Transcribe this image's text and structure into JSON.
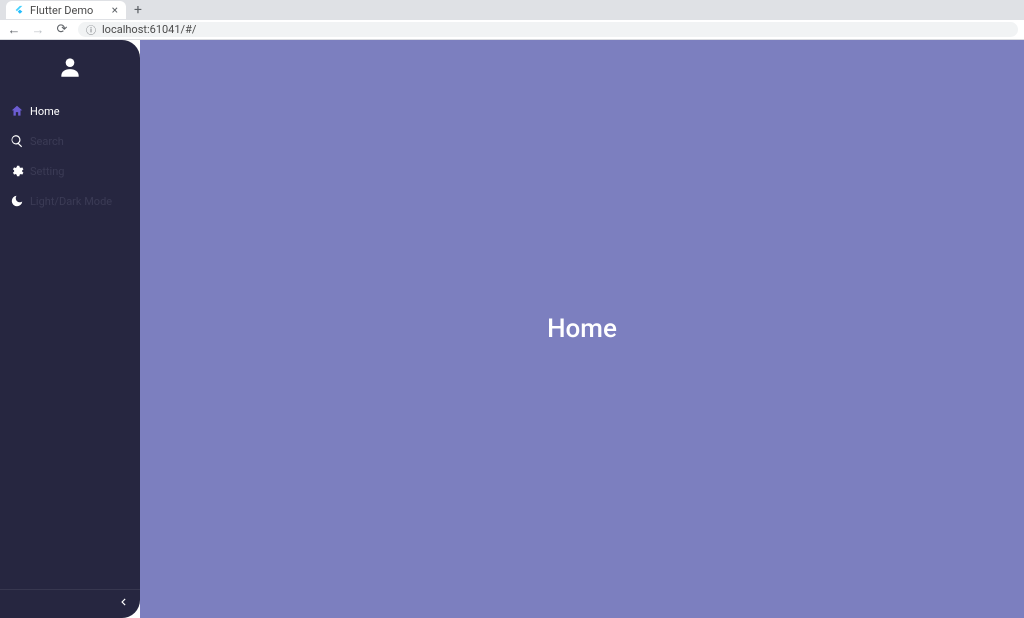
{
  "browser": {
    "tab_title": "Flutter Demo",
    "url": "localhost:61041/#/"
  },
  "sidebar": {
    "items": [
      {
        "label": "Home",
        "icon": "home-icon",
        "active": true
      },
      {
        "label": "Search",
        "icon": "search-icon",
        "active": false
      },
      {
        "label": "Setting",
        "icon": "gear-icon",
        "active": false
      },
      {
        "label": "Light/Dark Mode",
        "icon": "moon-icon",
        "active": false
      }
    ]
  },
  "main": {
    "page_title": "Home"
  },
  "colors": {
    "sidebar_bg": "#262640",
    "main_bg": "#7c7fbf",
    "accent": "#6c5dd3"
  }
}
